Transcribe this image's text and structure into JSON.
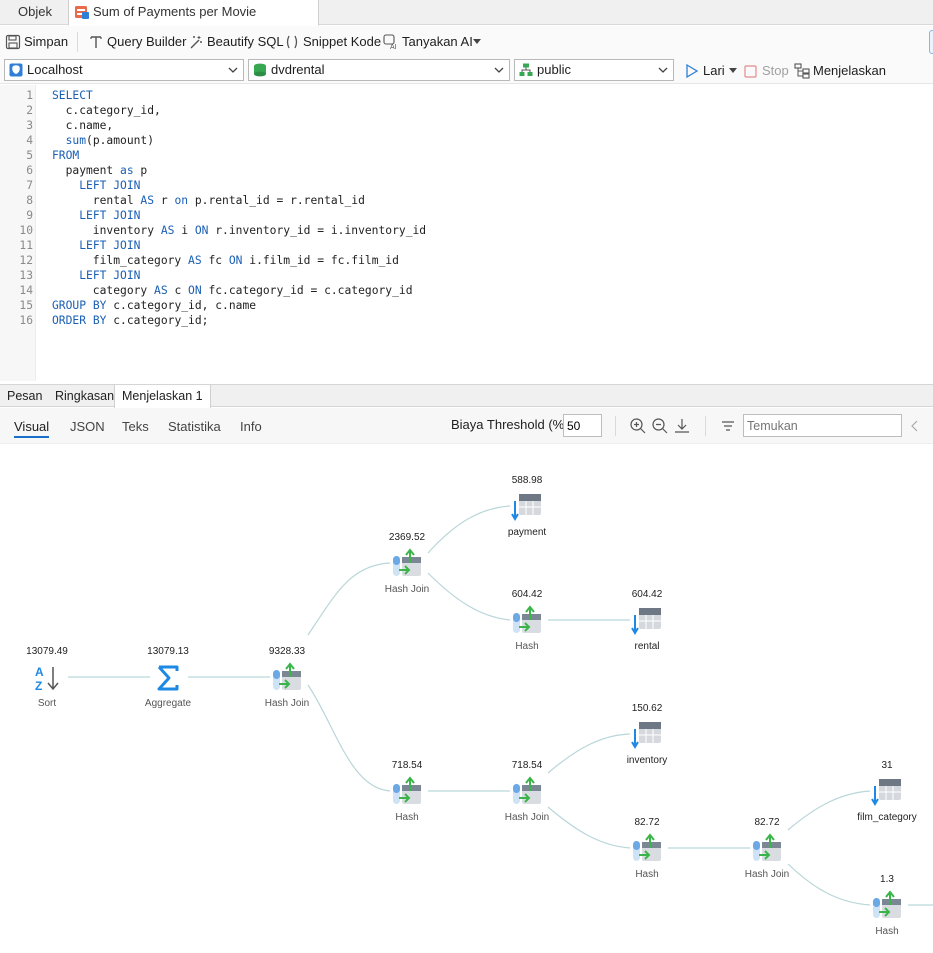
{
  "tabs": {
    "objects": "Objek",
    "query": "Sum of Payments per Movie Category ..."
  },
  "toolbar": {
    "save": "Simpan",
    "query_builder": "Query Builder",
    "beautify": "Beautify SQL",
    "snippet": "Snippet Kode",
    "ask_ai": "Tanyakan AI",
    "run": "Lari",
    "stop": "Stop",
    "explain": "Menjelaskan"
  },
  "connection": {
    "server": "Localhost",
    "database": "dvdrental",
    "schema": "public"
  },
  "editor": {
    "line_numbers": [
      "1",
      "2",
      "3",
      "4",
      "5",
      "6",
      "7",
      "8",
      "9",
      "10",
      "11",
      "12",
      "13",
      "14",
      "15",
      "16"
    ],
    "lines": [
      "SELECT",
      "  c.category_id,",
      "  c.name,",
      "  sum(p.amount)",
      "FROM",
      "  payment as p",
      "    LEFT JOIN",
      "      rental AS r on p.rental_id = r.rental_id",
      "    LEFT JOIN",
      "      inventory AS i ON r.inventory_id = i.inventory_id",
      "    LEFT JOIN",
      "      film_category AS fc ON i.film_id = fc.film_id",
      "    LEFT JOIN",
      "      category AS c ON fc.category_id = c.category_id",
      "GROUP BY c.category_id, c.name",
      "ORDER BY c.category_id;"
    ]
  },
  "result_tabs": [
    "Pesan",
    "Ringkasan",
    "Menjelaskan 1"
  ],
  "view_tabs": [
    "Visual",
    "JSON",
    "Teks",
    "Statistika",
    "Info"
  ],
  "threshold": {
    "label": "Biaya Threshold (%):",
    "value": "50"
  },
  "find": {
    "placeholder": "Temukan"
  },
  "plan": {
    "nodes": {
      "sort": {
        "cost": "13079.49",
        "label": "Sort"
      },
      "aggregate": {
        "cost": "13079.13",
        "label": "Aggregate"
      },
      "hashjoin1": {
        "cost": "9328.33",
        "label": "Hash Join"
      },
      "hashjoin2": {
        "cost": "2369.52",
        "label": "Hash Join"
      },
      "payment": {
        "cost": "588.98",
        "label": "payment"
      },
      "hash1": {
        "cost": "604.42",
        "label": "Hash"
      },
      "rental": {
        "cost": "604.42",
        "label": "rental"
      },
      "hash2": {
        "cost": "718.54",
        "label": "Hash"
      },
      "hashjoin3": {
        "cost": "718.54",
        "label": "Hash Join"
      },
      "inventory": {
        "cost": "150.62",
        "label": "inventory"
      },
      "hash3": {
        "cost": "82.72",
        "label": "Hash"
      },
      "hashjoin4": {
        "cost": "82.72",
        "label": "Hash Join"
      },
      "film_category": {
        "cost": "31",
        "label": "film_category"
      },
      "hash4": {
        "cost": "1.3",
        "label": "Hash"
      }
    }
  },
  "colors": {
    "keyword": "#1a5fb4",
    "accent": "#1a6fc9",
    "edge": "#b9d6d9",
    "arrow_green": "#3bb54a",
    "scan_blue": "#1e88e5"
  }
}
